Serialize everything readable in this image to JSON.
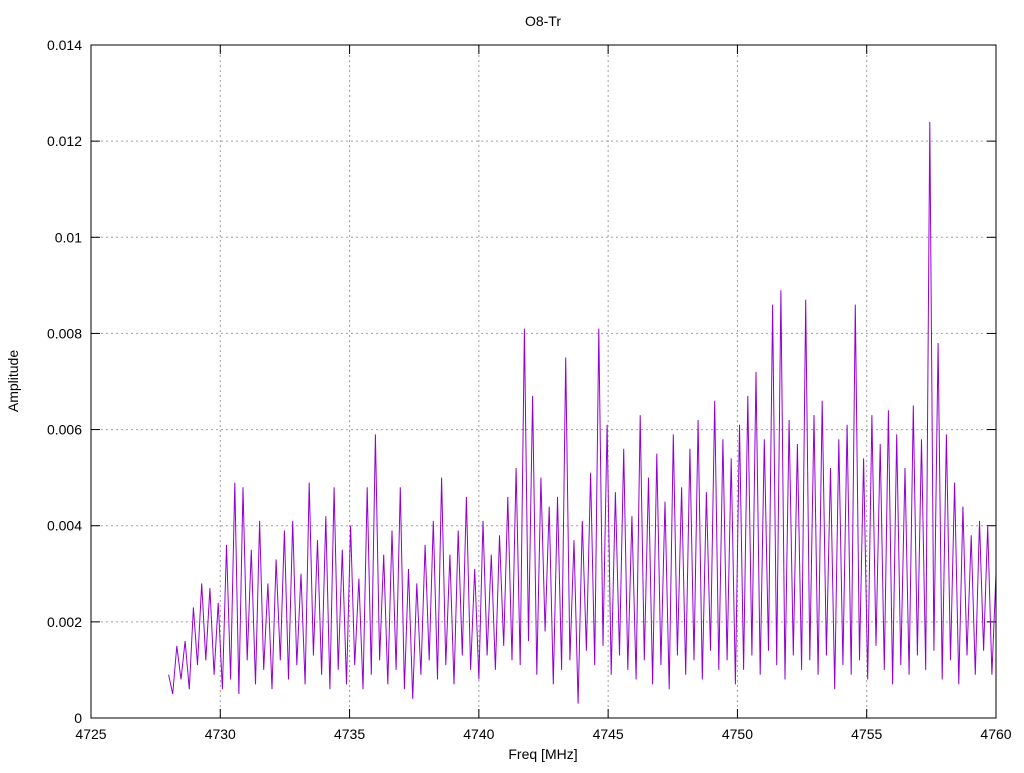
{
  "chart_data": {
    "type": "line",
    "title": "O8-Tr",
    "xlabel": "Freq [MHz]",
    "ylabel": "Amplitude",
    "xlim": [
      4725,
      4760
    ],
    "ylim": [
      0,
      0.014
    ],
    "xticks": [
      4725,
      4730,
      4735,
      4740,
      4745,
      4750,
      4755,
      4760
    ],
    "xtick_labels": [
      "4725",
      "4730",
      "4735",
      "4740",
      "4745",
      "4750",
      "4755",
      "4760"
    ],
    "yticks": [
      0,
      0.002,
      0.004,
      0.006,
      0.008,
      0.01,
      0.012,
      0.014
    ],
    "ytick_labels": [
      "0",
      "0.002",
      "0.004",
      "0.006",
      "0.008",
      "0.01",
      "0.012",
      "0.014"
    ],
    "grid": true,
    "legend": "none",
    "series": [
      {
        "name": "O8-Tr",
        "color": "#9400d3",
        "x_start": 4728,
        "x_step": 0.16,
        "values": [
          0.0009,
          0.0005,
          0.0015,
          0.0008,
          0.0016,
          0.0006,
          0.0023,
          0.0011,
          0.0028,
          0.0012,
          0.0027,
          0.0009,
          0.0024,
          0.0006,
          0.0036,
          0.0008,
          0.0049,
          0.0005,
          0.0048,
          0.0012,
          0.0035,
          0.0007,
          0.0041,
          0.001,
          0.0028,
          0.0006,
          0.0033,
          0.0012,
          0.0039,
          0.0008,
          0.0041,
          0.0011,
          0.003,
          0.0007,
          0.0049,
          0.0013,
          0.0037,
          0.0009,
          0.0042,
          0.0006,
          0.0048,
          0.001,
          0.0035,
          0.0007,
          0.004,
          0.0011,
          0.0029,
          0.0006,
          0.0048,
          0.0009,
          0.0059,
          0.0012,
          0.0034,
          0.0007,
          0.0039,
          0.001,
          0.0048,
          0.0006,
          0.0031,
          0.0004,
          0.0028,
          0.0009,
          0.0036,
          0.0012,
          0.0041,
          0.0008,
          0.005,
          0.0011,
          0.0034,
          0.0007,
          0.0039,
          0.0013,
          0.0046,
          0.001,
          0.0031,
          0.0008,
          0.0041,
          0.0013,
          0.0034,
          0.001,
          0.0038,
          0.0015,
          0.0046,
          0.0012,
          0.0052,
          0.0011,
          0.0081,
          0.0016,
          0.0067,
          0.0009,
          0.005,
          0.0018,
          0.0044,
          0.0007,
          0.0046,
          0.001,
          0.0075,
          0.0012,
          0.0037,
          0.0003,
          0.0041,
          0.0014,
          0.0051,
          0.0011,
          0.0081,
          0.0015,
          0.0061,
          0.0009,
          0.0047,
          0.0013,
          0.0056,
          0.001,
          0.0042,
          0.0008,
          0.0063,
          0.0012,
          0.005,
          0.0007,
          0.0055,
          0.0011,
          0.0045,
          0.0006,
          0.0059,
          0.0013,
          0.0048,
          0.0009,
          0.0056,
          0.0012,
          0.0062,
          0.0008,
          0.0047,
          0.0014,
          0.0066,
          0.001,
          0.0058,
          0.0012,
          0.0054,
          0.0007,
          0.0061,
          0.001,
          0.0067,
          0.0013,
          0.0072,
          0.0009,
          0.0058,
          0.0014,
          0.0086,
          0.0011,
          0.0089,
          0.0008,
          0.0062,
          0.0013,
          0.0057,
          0.001,
          0.0087,
          0.0012,
          0.0063,
          0.0009,
          0.0066,
          0.0013,
          0.0052,
          0.0006,
          0.0058,
          0.0011,
          0.0061,
          0.0009,
          0.0086,
          0.0012,
          0.0054,
          0.0008,
          0.0063,
          0.0015,
          0.0057,
          0.001,
          0.0064,
          0.0007,
          0.0059,
          0.0011,
          0.0052,
          0.0009,
          0.0065,
          0.0013,
          0.0058,
          0.001,
          0.0124,
          0.0014,
          0.0078,
          0.0008,
          0.0059,
          0.0012,
          0.0049,
          0.0007,
          0.0044,
          0.0013,
          0.0038,
          0.0009,
          0.0041,
          0.0014,
          0.004,
          0.0009,
          0.003
        ]
      }
    ]
  }
}
